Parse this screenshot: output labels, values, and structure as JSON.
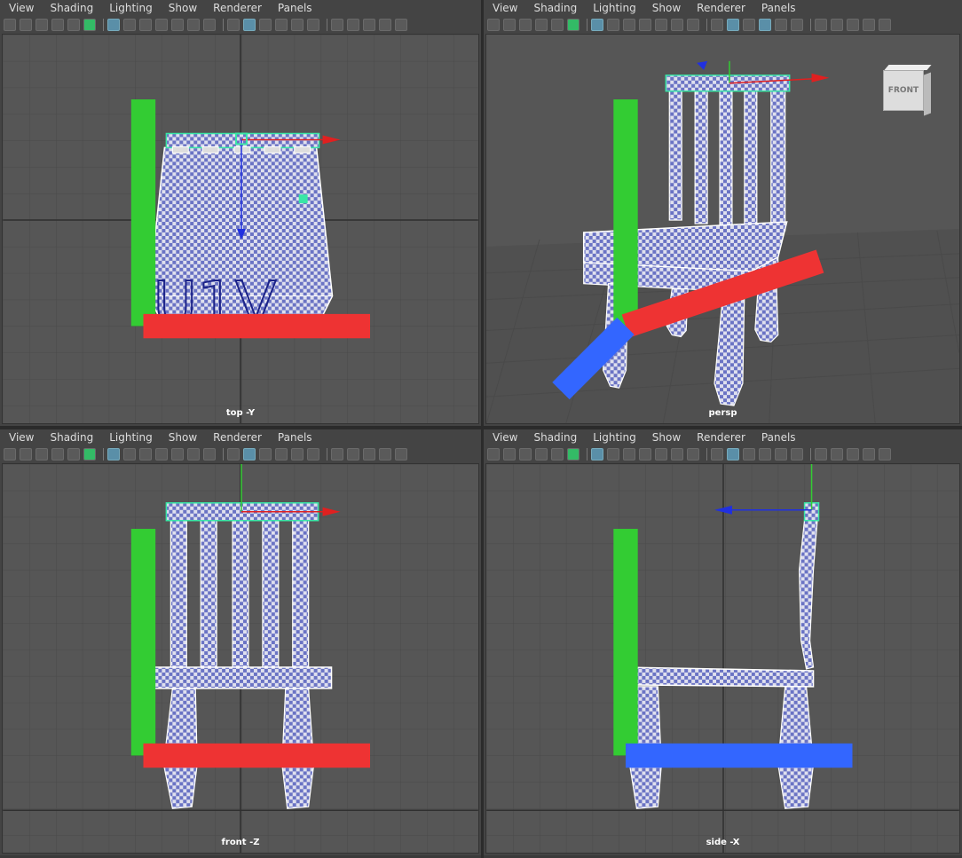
{
  "menus": [
    "View",
    "Shading",
    "Lighting",
    "Show",
    "Renderer",
    "Panels"
  ],
  "viewports": [
    {
      "camera": "top -Y",
      "uv_text": "U1V"
    },
    {
      "camera": "persp",
      "viewcube": "FRONT"
    },
    {
      "camera": "front -Z"
    },
    {
      "camera": "side -X"
    }
  ],
  "toolbar_icons": [
    "camera-icon",
    "camera-attr-icon",
    "bookmark-icon",
    "image-plane-icon",
    "2d-pan-zoom-icon",
    "grease-pencil-icon",
    "grid-icon",
    "film-gate-icon",
    "resolution-gate-icon",
    "gate-mask-icon",
    "field-chart-icon",
    "safe-action-icon",
    "wireframe-icon",
    "smooth-shade-icon",
    "default-material-icon",
    "textured-icon",
    "lights-icon",
    "shadows-icon",
    "ambient-occlusion-icon",
    "motion-blur-icon",
    "anti-alias-icon",
    "xray-icon",
    "isolate-icon"
  ],
  "colors": {
    "viewport_bg": "#565656",
    "grid": "#4a4a4a",
    "grid_axis": "#2f2f2f",
    "uv_blue": "#6a73c4",
    "wire": "#ffffff",
    "selection": "#39e6a6"
  }
}
